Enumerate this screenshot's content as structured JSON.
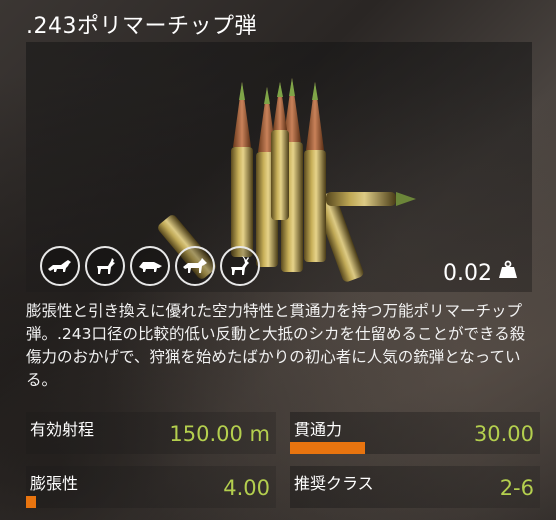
{
  "item": {
    "title": ".243ポリマーチップ弾",
    "weight": "0.02",
    "description": "膨張性と引き換えに優れた空力特性と貫通力を持つ万能ポリマーチップ弾。.243口径の比較的低い反動と大抵のシカを仕留めることができる殺傷力のおかげで、狩猟を始めたばかりの初心者に人気の銃弾となっている。"
  },
  "animals": [
    {
      "icon": "fox-icon"
    },
    {
      "icon": "roe-deer-icon"
    },
    {
      "icon": "boar-icon"
    },
    {
      "icon": "wolf-icon"
    },
    {
      "icon": "deer-icon"
    }
  ],
  "stats": {
    "range": {
      "label": "有効射程",
      "value": "150.00 m"
    },
    "penetration": {
      "label": "貫通力",
      "value": "30.00",
      "fill": 0.3
    },
    "expansion": {
      "label": "膨張性",
      "value": "4.00",
      "fill": 0.04
    },
    "class": {
      "label": "推奨クラス",
      "value": "2-6"
    }
  },
  "colors": {
    "accent_value": "#b4cf4e",
    "bar_fill": "#e8740f"
  }
}
